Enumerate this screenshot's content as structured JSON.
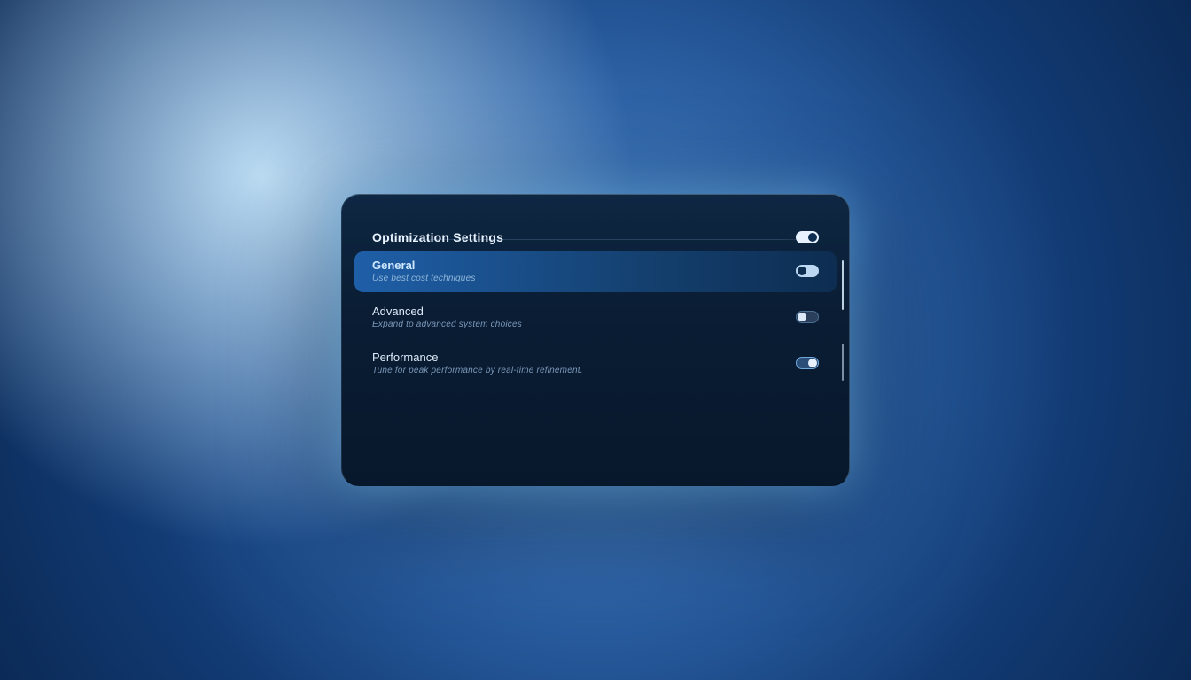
{
  "panel": {
    "title": "Optimization Settings",
    "items": [
      {
        "label": "General",
        "desc": "Use best cost techniques",
        "selected": true,
        "toggle": "on"
      },
      {
        "label": "Advanced",
        "desc": "Expand to advanced system choices",
        "selected": false,
        "toggle": "off"
      },
      {
        "label": "Performance",
        "desc": "Tune for peak performance by real-time refinement.",
        "selected": false,
        "toggle": "on"
      }
    ]
  }
}
